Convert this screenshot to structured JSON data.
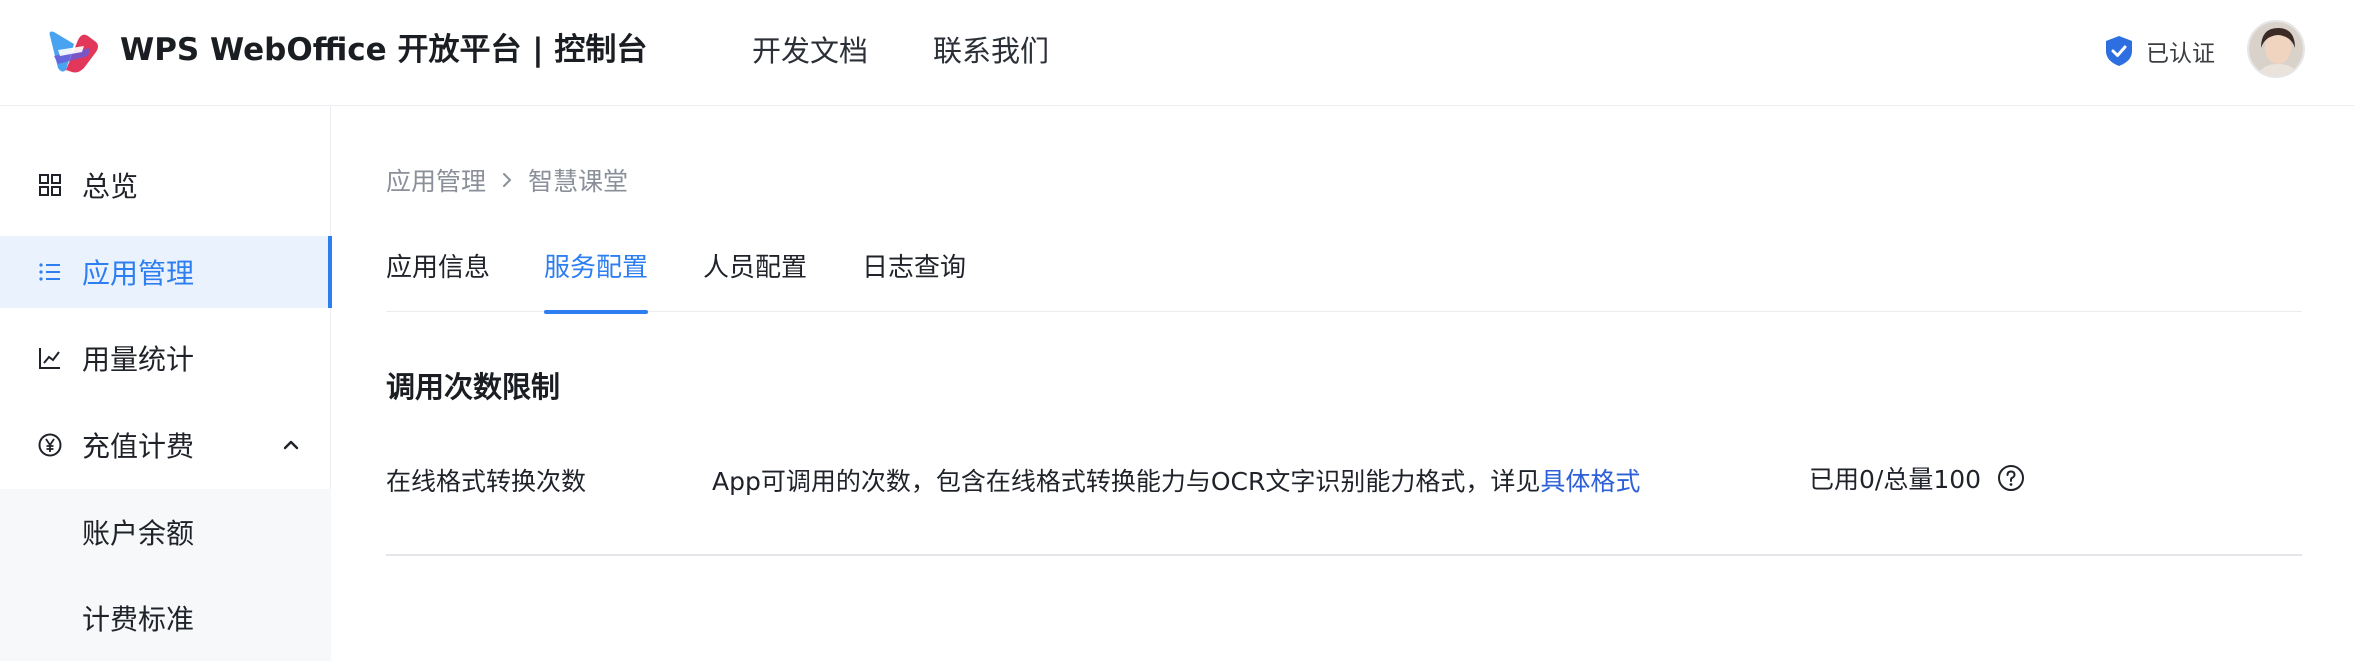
{
  "header": {
    "brand": "WPS WebOffice 开放平台 | 控制台",
    "nav": [
      "开发文档",
      "联系我们"
    ],
    "verified_label": "已认证"
  },
  "sidebar": {
    "items": [
      {
        "label": "总览",
        "icon": "grid-icon"
      },
      {
        "label": "应用管理",
        "icon": "list-icon",
        "active": true
      },
      {
        "label": "用量统计",
        "icon": "line-chart-icon"
      },
      {
        "label": "充值计费",
        "icon": "yen-icon",
        "expanded": true
      },
      {
        "label": "账户余额"
      },
      {
        "label": "计费标准"
      }
    ]
  },
  "breadcrumb": {
    "parent": "应用管理",
    "current": "智慧课堂"
  },
  "tabs": [
    "应用信息",
    "服务配置",
    "人员配置",
    "日志查询"
  ],
  "active_tab": "服务配置",
  "section": {
    "title": "调用次数限制",
    "row": {
      "name": "在线格式转换次数",
      "description": "App可调用的次数，包含在线格式转换能力与OCR文字识别能力格式，详见",
      "link": "具体格式",
      "usage": "已用0/总量100"
    }
  },
  "colors": {
    "accent": "#2d7ef0",
    "link": "#2d60d8",
    "active_bg": "#eaf2fd",
    "sub_bg": "#f7f8fa"
  }
}
